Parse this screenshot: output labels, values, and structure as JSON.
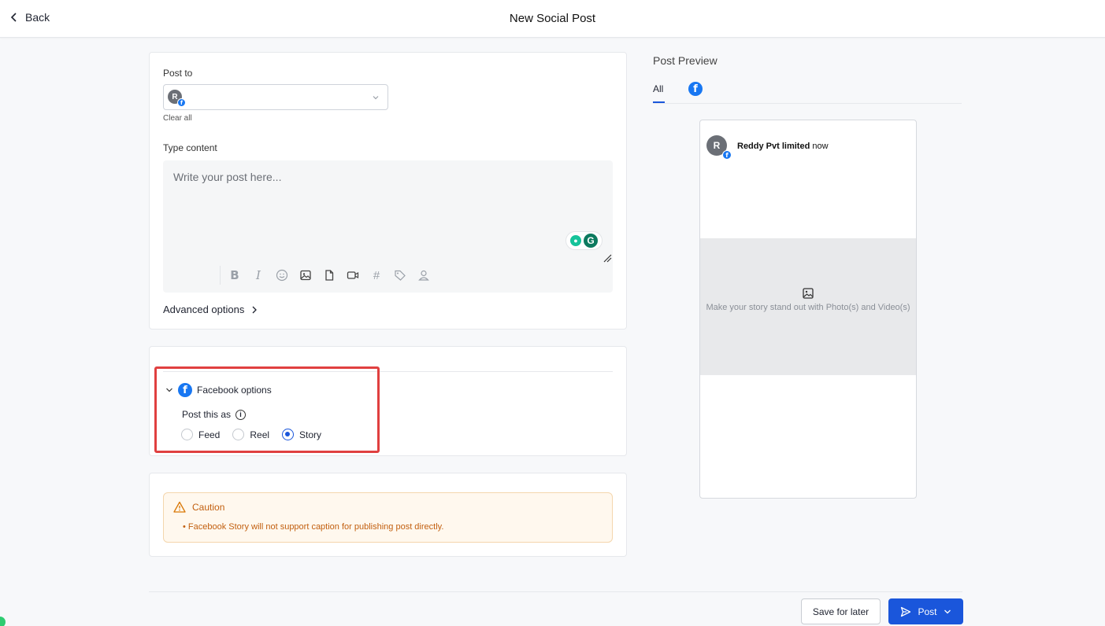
{
  "header": {
    "back_label": "Back",
    "title": "New Social Post"
  },
  "composer": {
    "post_to_label": "Post to",
    "account_initial": "R",
    "clear_all_label": "Clear all",
    "type_content_label": "Type content",
    "content_placeholder": "Write your post here...",
    "toolbar_icons": [
      "bold-icon",
      "italic-icon",
      "emoji-icon",
      "image-icon",
      "document-icon",
      "video-icon",
      "hashtag-icon",
      "tag-icon",
      "user-mention-icon"
    ],
    "advanced_options_label": "Advanced options"
  },
  "facebook_options": {
    "title": "Facebook options",
    "post_as_label": "Post this as",
    "options": [
      {
        "label": "Feed",
        "selected": false
      },
      {
        "label": "Reel",
        "selected": false
      },
      {
        "label": "Story",
        "selected": true
      }
    ]
  },
  "caution": {
    "title": "Caution",
    "items": [
      "Facebook Story will not support caption for publishing post directly."
    ]
  },
  "preview": {
    "title": "Post Preview",
    "tab_all": "All",
    "account_name": "Reddy Pvt limited",
    "time": "now",
    "media_placeholder": "Make your story stand out with Photo(s) and Video(s)"
  },
  "footer": {
    "save_label": "Save for later",
    "post_label": "Post"
  },
  "colors": {
    "primary": "#1a56db",
    "facebook": "#1877f2",
    "caution": "#c25f0f",
    "highlight": "#e04040"
  }
}
